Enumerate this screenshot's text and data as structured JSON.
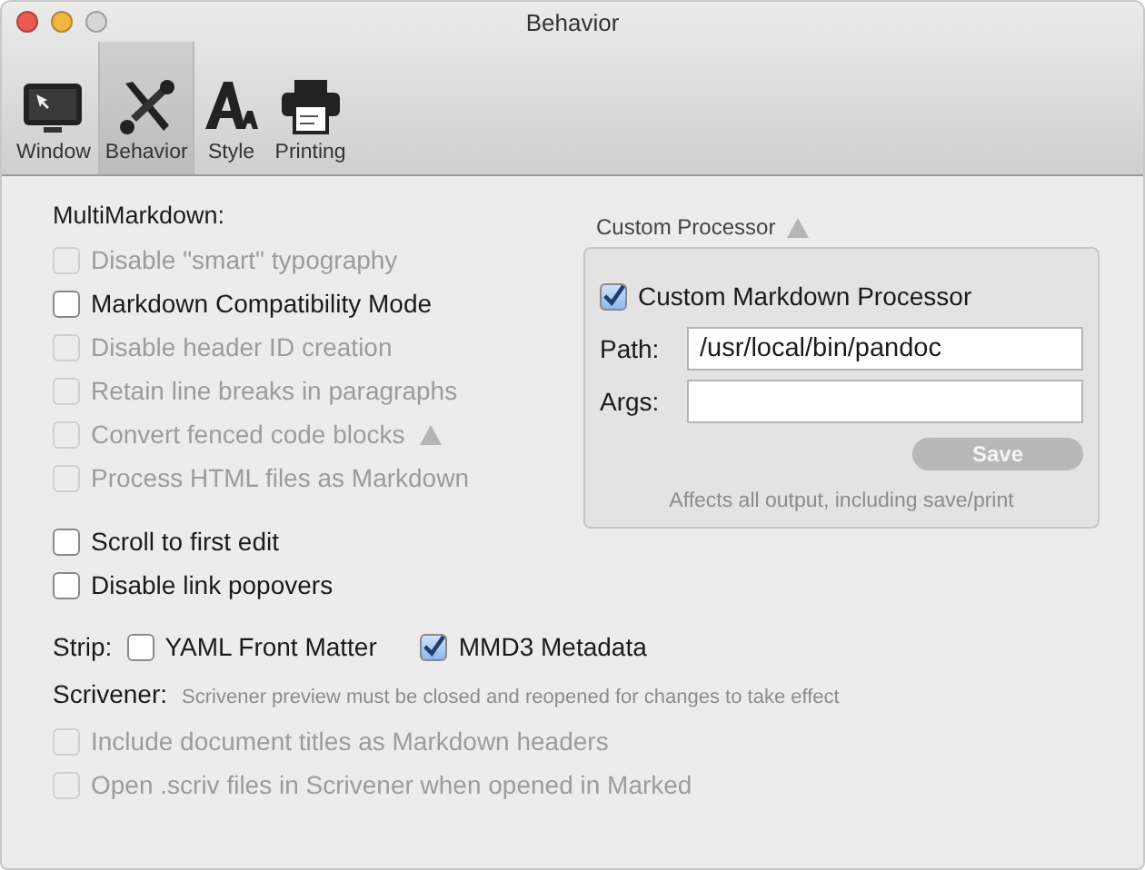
{
  "window": {
    "title": "Behavior"
  },
  "toolbar": [
    {
      "label": "Window",
      "kind": "window",
      "selected": false
    },
    {
      "label": "Behavior",
      "kind": "behavior",
      "selected": true
    },
    {
      "label": "Style",
      "kind": "style",
      "selected": false
    },
    {
      "label": "Printing",
      "kind": "printing",
      "selected": false
    }
  ],
  "multimarkdown": {
    "heading": "MultiMarkdown:",
    "options": [
      {
        "label": "Disable \"smart\" typography",
        "checked": false,
        "disabled": true,
        "warning": false
      },
      {
        "label": "Markdown Compatibility Mode",
        "checked": false,
        "disabled": false,
        "warning": false
      },
      {
        "label": "Disable header ID creation",
        "checked": false,
        "disabled": true,
        "warning": false
      },
      {
        "label": "Retain line breaks in paragraphs",
        "checked": false,
        "disabled": true,
        "warning": false
      },
      {
        "label": "Convert fenced code blocks",
        "checked": false,
        "disabled": true,
        "warning": true
      },
      {
        "label": "Process HTML files as Markdown",
        "checked": false,
        "disabled": true,
        "warning": false
      }
    ]
  },
  "general_options": [
    {
      "label": "Scroll to first edit",
      "checked": false,
      "disabled": false
    },
    {
      "label": "Disable link popovers",
      "checked": false,
      "disabled": false
    }
  ],
  "custom_processor": {
    "title": "Custom Processor",
    "enable": {
      "label": "Custom Markdown Processor",
      "checked": true
    },
    "path": {
      "label": "Path:",
      "value": "/usr/local/bin/pandoc"
    },
    "args": {
      "label": "Args:"
    },
    "save_button": {
      "label": "Save",
      "disabled": true
    },
    "note": "Affects all output, including save/print"
  },
  "strip": {
    "label": "Strip:",
    "options": [
      {
        "label": "YAML Front Matter",
        "checked": false
      },
      {
        "label": "MMD3 Metadata",
        "checked": true
      }
    ]
  },
  "scrivener": {
    "label": "Scrivener:",
    "note": "Scrivener preview must be closed and reopened for changes to take effect",
    "options": [
      {
        "label": "Include document titles as Markdown headers",
        "checked": false,
        "disabled": true
      },
      {
        "label": "Open .scriv files in Scrivener when opened in Marked",
        "checked": false,
        "disabled": true
      }
    ]
  }
}
